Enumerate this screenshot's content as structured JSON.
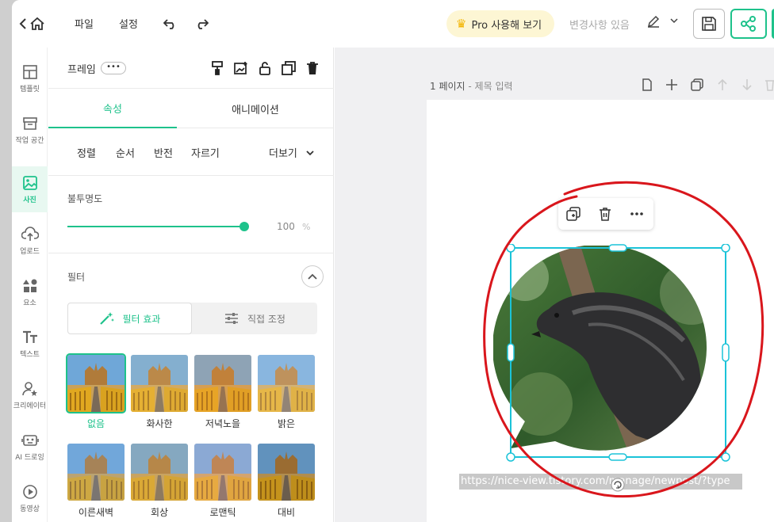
{
  "topbar": {
    "menu_file": "파일",
    "menu_settings": "설정",
    "pro_label": "Pro 사용해 보기",
    "changes_label": "변경사항 있음"
  },
  "leftnav": [
    {
      "label": "템플릿",
      "icon": "layout-icon"
    },
    {
      "label": "작업 공간",
      "icon": "archive-icon"
    },
    {
      "label": "사진",
      "icon": "photo-icon",
      "active": true
    },
    {
      "label": "업로드",
      "icon": "upload-icon"
    },
    {
      "label": "요소",
      "icon": "shapes-icon"
    },
    {
      "label": "텍스트",
      "icon": "text-icon"
    },
    {
      "label": "크리에이터",
      "icon": "creator-icon"
    },
    {
      "label": "AI 드로잉",
      "icon": "robot-icon"
    },
    {
      "label": "동영상",
      "icon": "play-icon"
    }
  ],
  "panel": {
    "frame_label": "프레임",
    "more_label": "•••",
    "tabs": [
      "속성",
      "애니메이션"
    ],
    "subtabs": [
      "정렬",
      "순서",
      "반전",
      "자르기"
    ],
    "more_menu": "더보기",
    "opacity_label": "불투명도",
    "opacity_value": "100",
    "opacity_unit": "%",
    "opacity_fraction": 1.0,
    "filter_label": "필터",
    "seg_filter": "필터 효과",
    "seg_adjust": "직접 조정",
    "filters": [
      "없음",
      "화사한",
      "저녁노을",
      "밝은",
      "이른새벽",
      "회상",
      "로맨틱",
      "대비"
    ]
  },
  "workspace": {
    "page_number": "1 페이지",
    "page_sep": " - ",
    "page_title_placeholder": "제목 입력",
    "url_text": "https://nice-view.tistory.com/manage/newpost/?type"
  },
  "colors": {
    "accent": "#1ec28b",
    "selection": "#1bc3d8",
    "annotation": "#d9161c",
    "pro_bg": "#fdf6d4"
  }
}
